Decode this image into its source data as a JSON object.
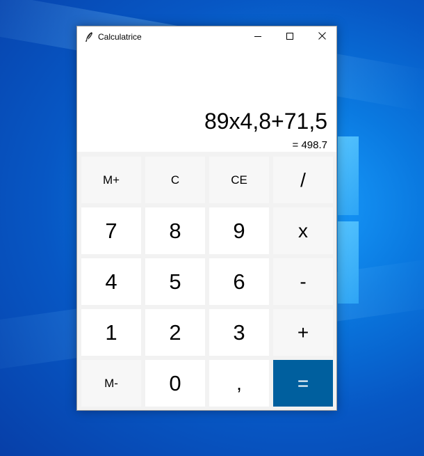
{
  "window": {
    "title": "Calculatrice"
  },
  "display": {
    "expression": "89x4,8+71,5",
    "result": "= 498.7"
  },
  "keys": [
    {
      "label": "M+",
      "name": "memory-add-button",
      "style": "light",
      "size": "small"
    },
    {
      "label": "C",
      "name": "clear-button",
      "style": "light",
      "size": "small"
    },
    {
      "label": "CE",
      "name": "clear-entry-button",
      "style": "light",
      "size": "small"
    },
    {
      "label": "/",
      "name": "divide-button",
      "style": "light",
      "size": "op"
    },
    {
      "label": "7",
      "name": "digit-7-button",
      "style": "white",
      "size": "big"
    },
    {
      "label": "8",
      "name": "digit-8-button",
      "style": "white",
      "size": "big"
    },
    {
      "label": "9",
      "name": "digit-9-button",
      "style": "white",
      "size": "big"
    },
    {
      "label": "x",
      "name": "multiply-button",
      "style": "light",
      "size": "op"
    },
    {
      "label": "4",
      "name": "digit-4-button",
      "style": "white",
      "size": "big"
    },
    {
      "label": "5",
      "name": "digit-5-button",
      "style": "white",
      "size": "big"
    },
    {
      "label": "6",
      "name": "digit-6-button",
      "style": "white",
      "size": "big"
    },
    {
      "label": "-",
      "name": "subtract-button",
      "style": "light",
      "size": "op"
    },
    {
      "label": "1",
      "name": "digit-1-button",
      "style": "white",
      "size": "big"
    },
    {
      "label": "2",
      "name": "digit-2-button",
      "style": "white",
      "size": "big"
    },
    {
      "label": "3",
      "name": "digit-3-button",
      "style": "white",
      "size": "big"
    },
    {
      "label": "+",
      "name": "add-button",
      "style": "light",
      "size": "op"
    },
    {
      "label": "M-",
      "name": "memory-subtract-button",
      "style": "light",
      "size": "small"
    },
    {
      "label": "0",
      "name": "digit-0-button",
      "style": "white",
      "size": "big"
    },
    {
      "label": ",",
      "name": "decimal-comma-button",
      "style": "white",
      "size": "op"
    },
    {
      "label": "=",
      "name": "equals-button",
      "style": "accent",
      "size": "op"
    }
  ],
  "colors": {
    "accent": "#005f9e",
    "key_light": "#f7f7f7",
    "key_white": "#ffffff",
    "window_bg": "#f2f2f2"
  },
  "icons": {
    "app": "feather-icon",
    "minimize": "minimize-icon",
    "maximize": "maximize-icon",
    "close": "close-icon"
  }
}
